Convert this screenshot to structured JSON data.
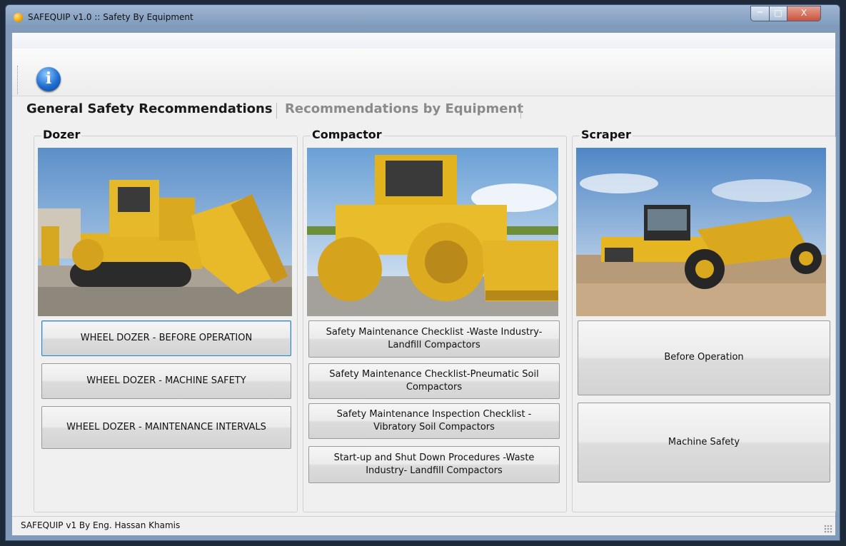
{
  "window": {
    "title": "SAFEQUIP v1.0 :: Safety By Equipment",
    "controls": {
      "minimize": "─",
      "maximize": "□",
      "close": "X"
    }
  },
  "toolbar": {
    "info_icon": "info-icon",
    "info_glyph": "i"
  },
  "tabs": [
    {
      "label": "General Safety Recommendations",
      "active": true
    },
    {
      "label": "Recommendations by Equipment",
      "active": false
    }
  ],
  "groups": {
    "dozer": {
      "title": "Dozer",
      "photo": "dozer-photo",
      "buttons": [
        "WHEEL DOZER - BEFORE OPERATION",
        "WHEEL DOZER - MACHINE SAFETY",
        "WHEEL DOZER - MAINTENANCE INTERVALS"
      ]
    },
    "compactor": {
      "title": "Compactor",
      "photo": "compactor-photo",
      "buttons": [
        "Safety  Maintenance Checklist -Waste Industry-Landfill Compactors",
        "Safety  Maintenance Checklist-Pneumatic Soil Compactors",
        "Safety  Maintenance Inspection Checklist - Vibratory Soil Compactors",
        "Start-up and Shut Down Procedures -Waste Industry- Landfill Compactors"
      ]
    },
    "scraper": {
      "title": "Scraper",
      "photo": "scraper-photo",
      "buttons": [
        "Before Operation",
        "Machine Safety"
      ]
    }
  },
  "status_bar": {
    "text": "SAFEQUIP v1 By Eng. Hassan Khamis"
  },
  "colors": {
    "title_bar": "#8aa4c4",
    "client_bg": "#f0f0f0",
    "machine_yellow": "#e5b622",
    "focus_border": "#3c7fb1"
  }
}
